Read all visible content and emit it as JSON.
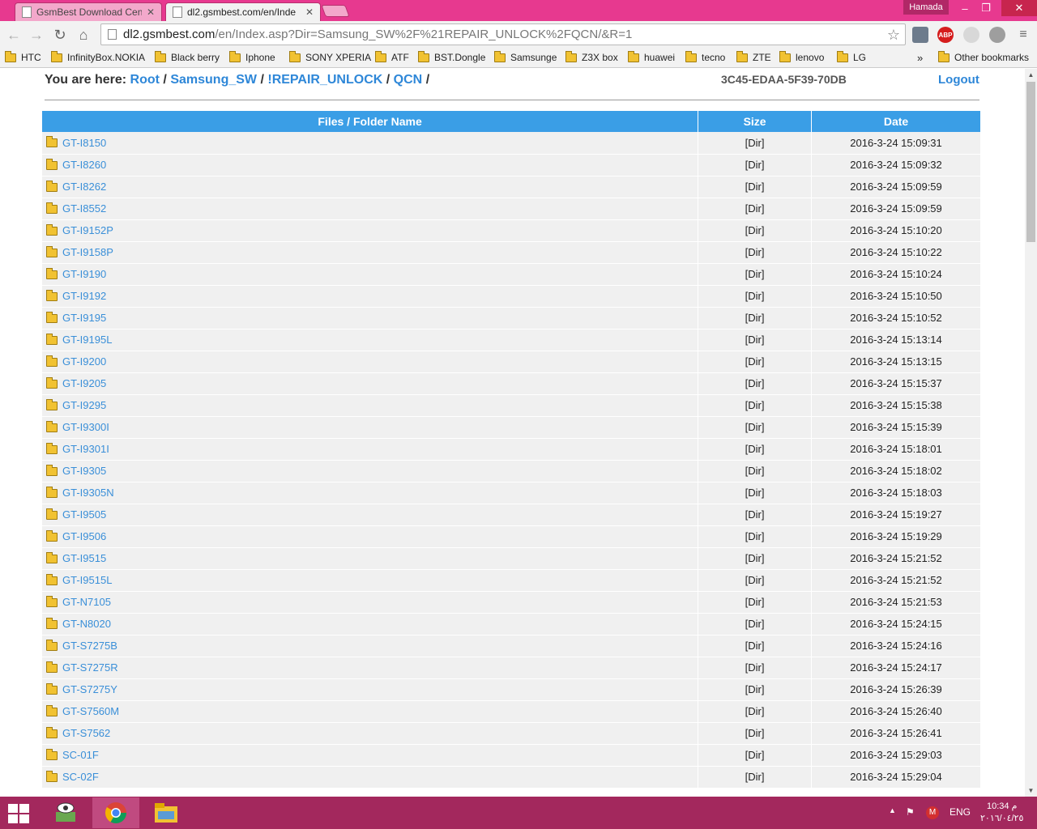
{
  "browser": {
    "tabs": [
      {
        "label": "GsmBest Download Cente",
        "active": false
      },
      {
        "label": "dl2.gsmbest.com/en/Inde",
        "active": true
      }
    ],
    "user": "Hamada",
    "url_host": "dl2.gsmbest.com",
    "url_path": "/en/Index.asp?Dir=Samsung_SW%2F%21REPAIR_UNLOCK%2FQCN/&R=1",
    "extensions": [
      "shield-icon",
      "ABP",
      "circle-icon",
      "globe-icon"
    ],
    "bookmarks": [
      "HTC",
      "InfinityBox.NOKIA",
      "Black berry",
      "Iphone",
      "SONY XPERIA",
      "ATF",
      "BST.Dongle",
      "Samsunge",
      "Z3X box",
      "huawei",
      "tecno",
      "ZTE",
      "lenovo",
      "LG"
    ],
    "bookmarks_overflow": "»",
    "other_bookmarks": "Other bookmarks"
  },
  "page": {
    "you_are_here": "You are here:",
    "crumbs": [
      "Root",
      "Samsung_SW",
      "!REPAIR_UNLOCK",
      "QCN"
    ],
    "separator": "/",
    "device_code": "3C45-EDAA-5F39-70DB",
    "logout": "Logout",
    "table": {
      "headers": [
        "Files / Folder Name",
        "Size",
        "Date"
      ],
      "rows": [
        {
          "name": "GT-I8150",
          "size": "[Dir]",
          "date": "2016-3-24 15:09:31"
        },
        {
          "name": "GT-I8260",
          "size": "[Dir]",
          "date": "2016-3-24 15:09:32"
        },
        {
          "name": "GT-I8262",
          "size": "[Dir]",
          "date": "2016-3-24 15:09:59"
        },
        {
          "name": "GT-I8552",
          "size": "[Dir]",
          "date": "2016-3-24 15:09:59"
        },
        {
          "name": "GT-I9152P",
          "size": "[Dir]",
          "date": "2016-3-24 15:10:20"
        },
        {
          "name": "GT-I9158P",
          "size": "[Dir]",
          "date": "2016-3-24 15:10:22"
        },
        {
          "name": "GT-I9190",
          "size": "[Dir]",
          "date": "2016-3-24 15:10:24"
        },
        {
          "name": "GT-I9192",
          "size": "[Dir]",
          "date": "2016-3-24 15:10:50"
        },
        {
          "name": "GT-I9195",
          "size": "[Dir]",
          "date": "2016-3-24 15:10:52"
        },
        {
          "name": "GT-I9195L",
          "size": "[Dir]",
          "date": "2016-3-24 15:13:14"
        },
        {
          "name": "GT-I9200",
          "size": "[Dir]",
          "date": "2016-3-24 15:13:15"
        },
        {
          "name": "GT-I9205",
          "size": "[Dir]",
          "date": "2016-3-24 15:15:37"
        },
        {
          "name": "GT-I9295",
          "size": "[Dir]",
          "date": "2016-3-24 15:15:38"
        },
        {
          "name": "GT-I9300I",
          "size": "[Dir]",
          "date": "2016-3-24 15:15:39"
        },
        {
          "name": "GT-I9301I",
          "size": "[Dir]",
          "date": "2016-3-24 15:18:01"
        },
        {
          "name": "GT-I9305",
          "size": "[Dir]",
          "date": "2016-3-24 15:18:02"
        },
        {
          "name": "GT-I9305N",
          "size": "[Dir]",
          "date": "2016-3-24 15:18:03"
        },
        {
          "name": "GT-I9505",
          "size": "[Dir]",
          "date": "2016-3-24 15:19:27"
        },
        {
          "name": "GT-I9506",
          "size": "[Dir]",
          "date": "2016-3-24 15:19:29"
        },
        {
          "name": "GT-I9515",
          "size": "[Dir]",
          "date": "2016-3-24 15:21:52"
        },
        {
          "name": "GT-I9515L",
          "size": "[Dir]",
          "date": "2016-3-24 15:21:52"
        },
        {
          "name": "GT-N7105",
          "size": "[Dir]",
          "date": "2016-3-24 15:21:53"
        },
        {
          "name": "GT-N8020",
          "size": "[Dir]",
          "date": "2016-3-24 15:24:15"
        },
        {
          "name": "GT-S7275B",
          "size": "[Dir]",
          "date": "2016-3-24 15:24:16"
        },
        {
          "name": "GT-S7275R",
          "size": "[Dir]",
          "date": "2016-3-24 15:24:17"
        },
        {
          "name": "GT-S7275Y",
          "size": "[Dir]",
          "date": "2016-3-24 15:26:39"
        },
        {
          "name": "GT-S7560M",
          "size": "[Dir]",
          "date": "2016-3-24 15:26:40"
        },
        {
          "name": "GT-S7562",
          "size": "[Dir]",
          "date": "2016-3-24 15:26:41"
        },
        {
          "name": "SC-01F",
          "size": "[Dir]",
          "date": "2016-3-24 15:29:03"
        },
        {
          "name": "SC-02F",
          "size": "[Dir]",
          "date": "2016-3-24 15:29:04"
        }
      ]
    }
  },
  "taskbar": {
    "apps": [
      "viewer-app-icon",
      "chrome-icon",
      "file-explorer-icon"
    ],
    "language": "ENG",
    "time": "10:34 م",
    "date": "٢٠١٦/٠٤/٢٥"
  },
  "colors": {
    "titlebar": "#e7398f",
    "table_header": "#3a9ee6",
    "link": "#2e87d8",
    "taskbar": "#a3285d"
  }
}
